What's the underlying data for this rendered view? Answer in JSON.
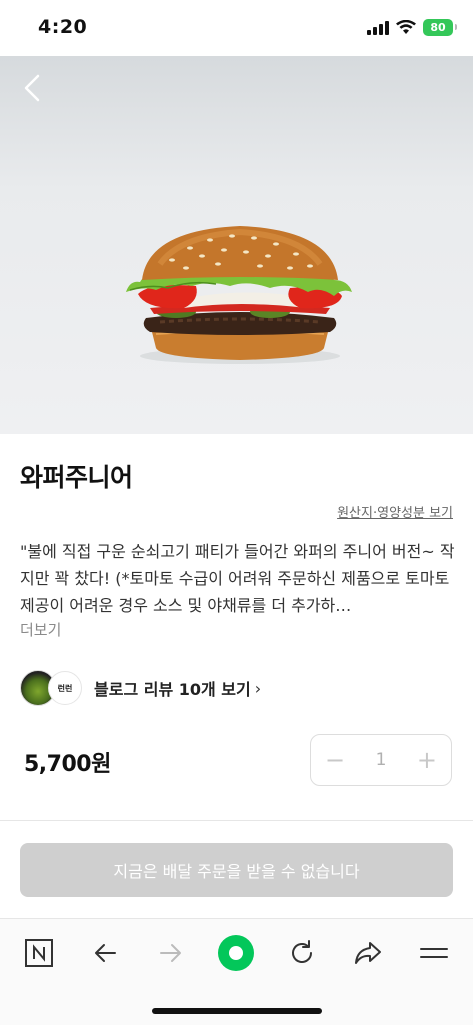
{
  "status_bar": {
    "time": "4:20",
    "battery": "80"
  },
  "product": {
    "name": "와퍼주니어",
    "origin_link": "원산지·영양성분 보기",
    "description": "\"불에 직접 구운 순쇠고기 패티가 들어간 와퍼의 주니어 버전~ 작지만 꽉 찼다! (*토마토 수급이 어려워 주문하신 제품으로 토마토 제공이 어려운 경우 소스 및 야채류를 더 추가하…",
    "more_label": "더보기",
    "price": "5,700원"
  },
  "blog": {
    "badge_text": "런런",
    "label": "블로그 리뷰 10개 보기"
  },
  "quantity": {
    "minus": "−",
    "value": "1",
    "plus": "+"
  },
  "order_button": {
    "label": "지금은 배달 주문을 받을 수 없습니다"
  },
  "colors": {
    "brand_green": "#03c75a",
    "disabled": "#cfcfcf",
    "battery": "#34c759"
  },
  "icons": [
    "back-icon",
    "naver-n-icon",
    "arrow-left-icon",
    "arrow-right-icon",
    "green-dot-icon",
    "refresh-icon",
    "share-icon",
    "menu-icon"
  ]
}
